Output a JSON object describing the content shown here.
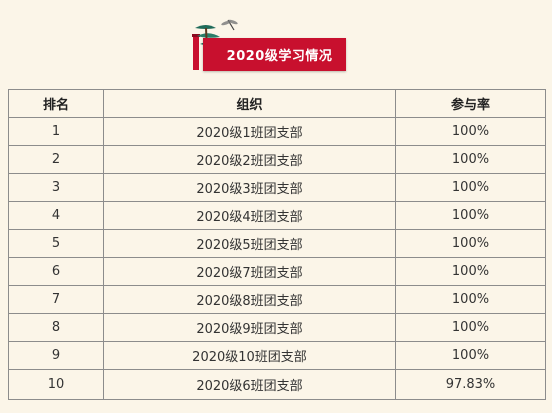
{
  "banner": {
    "title": "2020级学习情况"
  },
  "table": {
    "headers": [
      "排名",
      "组织",
      "参与率"
    ],
    "rows": [
      [
        "1",
        "2020级1班团支部",
        "100%"
      ],
      [
        "2",
        "2020级2班团支部",
        "100%"
      ],
      [
        "3",
        "2020级3班团支部",
        "100%"
      ],
      [
        "4",
        "2020级4班团支部",
        "100%"
      ],
      [
        "5",
        "2020级5班团支部",
        "100%"
      ],
      [
        "6",
        "2020级7班团支部",
        "100%"
      ],
      [
        "7",
        "2020级8班团支部",
        "100%"
      ],
      [
        "8",
        "2020级9班团支部",
        "100%"
      ],
      [
        "9",
        "2020级10班团支部",
        "100%"
      ],
      [
        "10",
        "2020级6班团支部",
        "97.83%"
      ]
    ]
  },
  "colors": {
    "background": "#fbf5e8",
    "banner": "#c8102e",
    "pine": "#1f6b5a",
    "border": "#8c8c8c"
  }
}
